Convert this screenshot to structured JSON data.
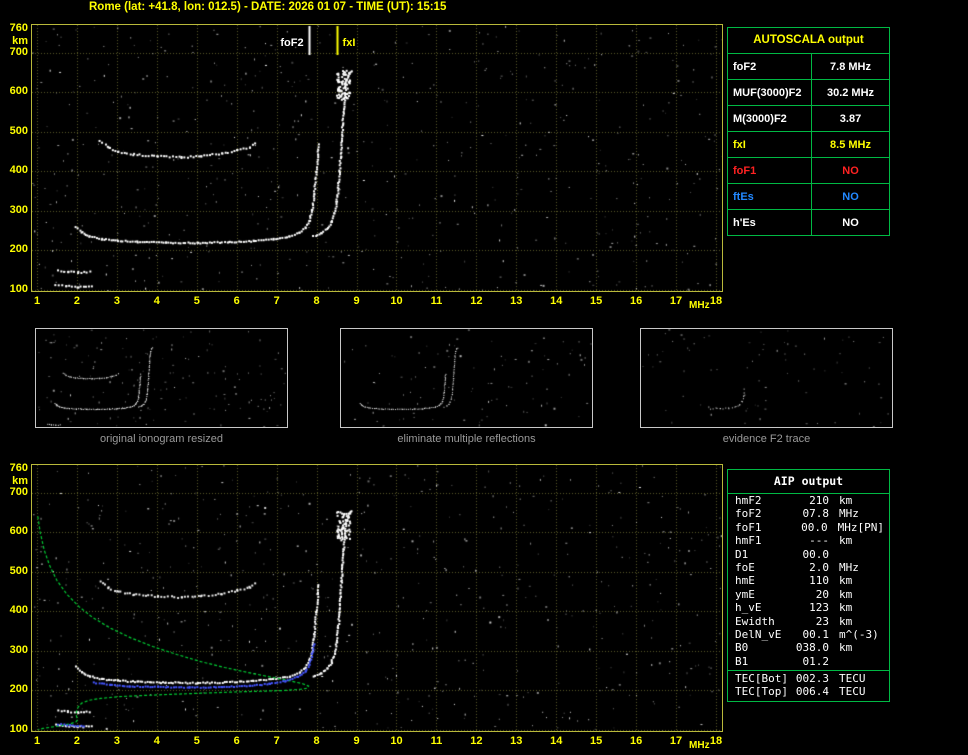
{
  "header": {
    "title": "Rome (lat: +41.8, lon: 012.5) - DATE: 2026 01 07 - TIME (UT): 15:15"
  },
  "colors": {
    "accent_yellow": "#ffff00",
    "grid": "#5c5c28",
    "plot_border": "#b9b93a",
    "table_border": "#00b944",
    "trace_white": "#ffffff",
    "profile_green": "#00cc33",
    "fitted_blue": "#4455ff",
    "no_red": "#ff2222",
    "es_blue": "#2288ff",
    "caption_gray": "#9a9a9a"
  },
  "autoscala_table": {
    "title": "AUTOSCALA output",
    "rows": [
      {
        "label": "foF2",
        "value": "7.8 MHz",
        "color": "#ffffff"
      },
      {
        "label": "MUF(3000)F2",
        "value": "30.2 MHz",
        "color": "#ffffff"
      },
      {
        "label": "M(3000)F2",
        "value": "3.87",
        "color": "#ffffff"
      },
      {
        "label": "fxI",
        "value": "8.5 MHz",
        "color": "#ffff00"
      },
      {
        "label": "foF1",
        "value": "NO",
        "color": "#ff2222"
      },
      {
        "label": "ftEs",
        "value": "NO",
        "color": "#2288ff"
      },
      {
        "label": "h'Es",
        "value": "NO",
        "color": "#ffffff"
      }
    ]
  },
  "aip_table": {
    "title": "AIP output",
    "rows": [
      {
        "label": "hmF2",
        "value": "210",
        "unit": "km",
        "extra": ""
      },
      {
        "label": "foF2",
        "value": "07.8",
        "unit": "MHz",
        "extra": ""
      },
      {
        "label": "foF1",
        "value": "00.0",
        "unit": "MHz",
        "extra": "[PN]"
      },
      {
        "label": "hmF1",
        "value": "---",
        "unit": "km",
        "extra": ""
      },
      {
        "label": "D1",
        "value": "00.0",
        "unit": "",
        "extra": ""
      },
      {
        "label": "foE",
        "value": "2.0",
        "unit": "MHz",
        "extra": ""
      },
      {
        "label": "hmE",
        "value": "110",
        "unit": "km",
        "extra": ""
      },
      {
        "label": "ymE",
        "value": "20",
        "unit": "km",
        "extra": ""
      },
      {
        "label": "h_vE",
        "value": "123",
        "unit": "km",
        "extra": ""
      },
      {
        "label": "Ewidth",
        "value": "23",
        "unit": "km",
        "extra": ""
      },
      {
        "label": "DelN_vE",
        "value": "00.1",
        "unit": "m^(-3)",
        "extra": ""
      },
      {
        "label": "B0",
        "value": "038.0",
        "unit": "km",
        "extra": ""
      },
      {
        "label": "B1",
        "value": "01.2",
        "unit": "",
        "extra": ""
      }
    ],
    "tec_rows": [
      {
        "label": "TEC[Bot]",
        "value": "002.3",
        "unit": "TECU",
        "extra": ""
      },
      {
        "label": "TEC[Top]",
        "value": "006.4",
        "unit": "TECU",
        "extra": ""
      }
    ]
  },
  "thumbnails": [
    {
      "caption": "original ionogram resized"
    },
    {
      "caption": "eliminate multiple reflections"
    },
    {
      "caption": "evidence F2 trace"
    }
  ],
  "chart_data": {
    "type": "scatter",
    "description": "Ionogram (virtual height km vs frequency MHz) with autoscaled trace and electron density profile",
    "xlim": [
      1,
      18
    ],
    "ylim": [
      100,
      760
    ],
    "x_axis": {
      "label": "MHz",
      "min": 1,
      "max": 18,
      "ticks": [
        1,
        2,
        3,
        4,
        5,
        6,
        7,
        8,
        9,
        10,
        11,
        12,
        13,
        14,
        15,
        16,
        17,
        18
      ]
    },
    "y_axis": {
      "label": "km",
      "min": 100,
      "max": 760,
      "ticks": [
        700,
        600,
        500,
        400,
        300,
        200,
        100
      ]
    },
    "markers": [
      {
        "id": "fof2",
        "label": "foF2",
        "freq": 7.8,
        "color": "#ffffff",
        "side": "left"
      },
      {
        "id": "fxi",
        "label": "fxI",
        "freq": 8.5,
        "color": "#ffff00",
        "side": "right"
      }
    ],
    "traces": {
      "f_trace": [
        [
          1.95,
          262
        ],
        [
          2.1,
          248
        ],
        [
          2.3,
          238
        ],
        [
          2.6,
          231
        ],
        [
          3.0,
          227
        ],
        [
          3.5,
          224
        ],
        [
          4.2,
          222
        ],
        [
          5.0,
          221
        ],
        [
          5.8,
          223
        ],
        [
          6.4,
          226
        ],
        [
          6.9,
          231
        ],
        [
          7.3,
          238
        ],
        [
          7.55,
          248
        ],
        [
          7.7,
          260
        ],
        [
          7.8,
          278
        ],
        [
          7.87,
          305
        ],
        [
          7.92,
          345
        ],
        [
          7.97,
          400
        ],
        [
          8.01,
          445
        ],
        [
          8.03,
          470
        ]
      ],
      "x_branch": [
        [
          7.9,
          238
        ],
        [
          8.1,
          246
        ],
        [
          8.25,
          258
        ],
        [
          8.35,
          273
        ],
        [
          8.43,
          295
        ],
        [
          8.48,
          325
        ],
        [
          8.52,
          360
        ],
        [
          8.55,
          400
        ],
        [
          8.58,
          440
        ],
        [
          8.6,
          480
        ],
        [
          8.63,
          520
        ],
        [
          8.66,
          560
        ],
        [
          8.69,
          600
        ],
        [
          8.73,
          632
        ],
        [
          8.79,
          650
        ],
        [
          8.86,
          656
        ]
      ],
      "multiple": [
        [
          2.55,
          480
        ],
        [
          2.75,
          463
        ],
        [
          3.0,
          452
        ],
        [
          3.4,
          445
        ],
        [
          4.0,
          440
        ],
        [
          4.6,
          438
        ],
        [
          5.1,
          441
        ],
        [
          5.6,
          447
        ],
        [
          6.0,
          455
        ],
        [
          6.3,
          464
        ],
        [
          6.45,
          472
        ]
      ],
      "es_high": [
        [
          1.5,
          152
        ],
        [
          1.75,
          149
        ],
        [
          2.0,
          147
        ],
        [
          2.3,
          148
        ]
      ],
      "es_low": [
        [
          1.45,
          115
        ],
        [
          1.7,
          112
        ],
        [
          2.0,
          110
        ],
        [
          2.35,
          111
        ]
      ],
      "f2_evidence": [
        [
          5.5,
          223
        ],
        [
          6.2,
          226
        ],
        [
          6.8,
          230
        ],
        [
          7.3,
          238
        ],
        [
          7.6,
          252
        ],
        [
          7.78,
          275
        ],
        [
          7.88,
          315
        ],
        [
          7.94,
          365
        ]
      ]
    },
    "profile_green": [
      [
        1.02,
        640
      ],
      [
        1.08,
        600
      ],
      [
        1.18,
        555
      ],
      [
        1.32,
        515
      ],
      [
        1.5,
        478
      ],
      [
        1.75,
        443
      ],
      [
        2.05,
        412
      ],
      [
        2.4,
        384
      ],
      [
        2.85,
        357
      ],
      [
        3.35,
        333
      ],
      [
        3.9,
        311
      ],
      [
        4.5,
        291
      ],
      [
        5.1,
        273
      ],
      [
        5.7,
        258
      ],
      [
        6.3,
        245
      ],
      [
        6.9,
        233
      ],
      [
        7.35,
        224
      ],
      [
        7.65,
        217
      ],
      [
        7.8,
        211
      ],
      [
        7.78,
        206
      ],
      [
        7.6,
        203
      ],
      [
        7.2,
        200
      ],
      [
        6.6,
        198
      ],
      [
        5.9,
        196
      ],
      [
        5.1,
        193
      ],
      [
        4.3,
        190
      ],
      [
        3.6,
        187
      ],
      [
        3.0,
        184
      ],
      [
        2.6,
        180
      ],
      [
        2.3,
        175
      ],
      [
        2.12,
        168
      ],
      [
        2.03,
        158
      ],
      [
        1.99,
        147
      ],
      [
        1.98,
        138
      ],
      [
        2.0,
        131
      ],
      [
        2.02,
        126
      ],
      [
        1.98,
        121
      ],
      [
        1.85,
        116
      ],
      [
        1.6,
        111
      ],
      [
        1.35,
        107
      ],
      [
        1.15,
        104
      ],
      [
        1.03,
        101
      ]
    ],
    "fitted_blue": [
      [
        2.4,
        222
      ],
      [
        2.8,
        217
      ],
      [
        3.3,
        213
      ],
      [
        4.0,
        211
      ],
      [
        4.8,
        210
      ],
      [
        5.6,
        211
      ],
      [
        6.3,
        214
      ],
      [
        6.8,
        219
      ],
      [
        7.2,
        226
      ],
      [
        7.5,
        236
      ],
      [
        7.7,
        250
      ],
      [
        7.8,
        268
      ],
      [
        7.87,
        295
      ],
      [
        7.91,
        320
      ]
    ],
    "fitted_blue_es": [
      [
        1.5,
        117
      ],
      [
        1.8,
        114
      ],
      [
        2.15,
        112
      ]
    ],
    "noise": {
      "main_count": 560,
      "thumb_counts": [
        150,
        100,
        80
      ]
    }
  }
}
